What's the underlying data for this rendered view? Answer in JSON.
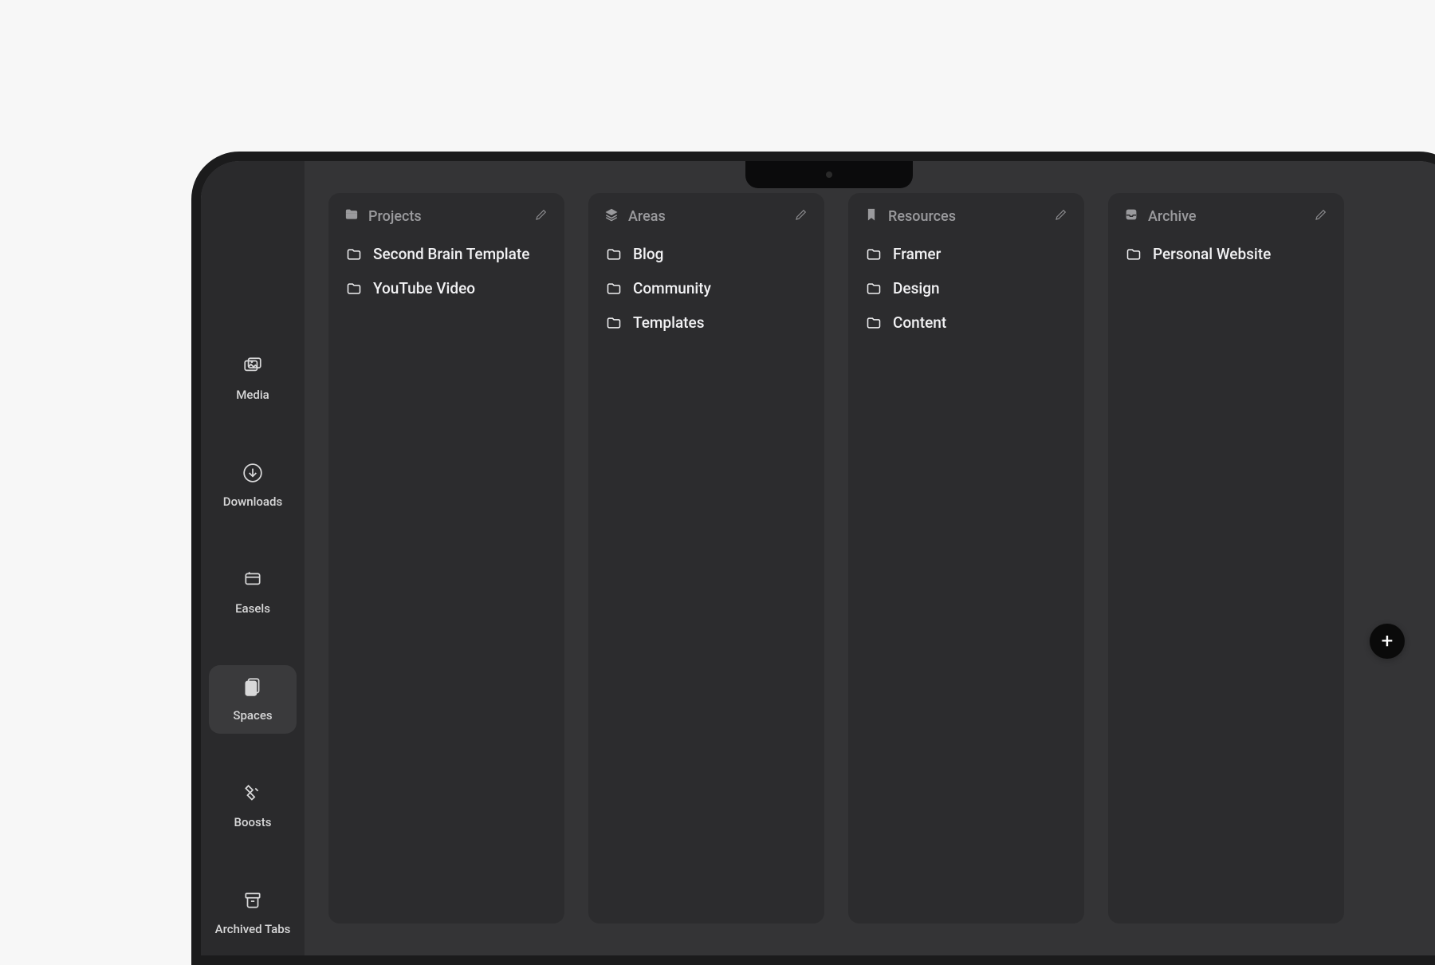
{
  "sidebar": {
    "items": [
      {
        "id": "media",
        "label": "Media"
      },
      {
        "id": "downloads",
        "label": "Downloads"
      },
      {
        "id": "easels",
        "label": "Easels"
      },
      {
        "id": "spaces",
        "label": "Spaces"
      },
      {
        "id": "boosts",
        "label": "Boosts"
      },
      {
        "id": "archived-tabs",
        "label": "Archived Tabs"
      }
    ],
    "active": "spaces"
  },
  "columns": [
    {
      "id": "projects",
      "title": "Projects",
      "icon": "folder-open",
      "items": [
        "Second Brain Template",
        "YouTube Video"
      ]
    },
    {
      "id": "areas",
      "title": "Areas",
      "icon": "layers",
      "items": [
        "Blog",
        "Community",
        "Templates"
      ]
    },
    {
      "id": "resources",
      "title": "Resources",
      "icon": "bookmark",
      "items": [
        "Framer",
        "Design",
        "Content"
      ]
    },
    {
      "id": "archive",
      "title": "Archive",
      "icon": "inbox",
      "items": [
        "Personal Website"
      ]
    }
  ],
  "fab": {
    "label": "+"
  }
}
